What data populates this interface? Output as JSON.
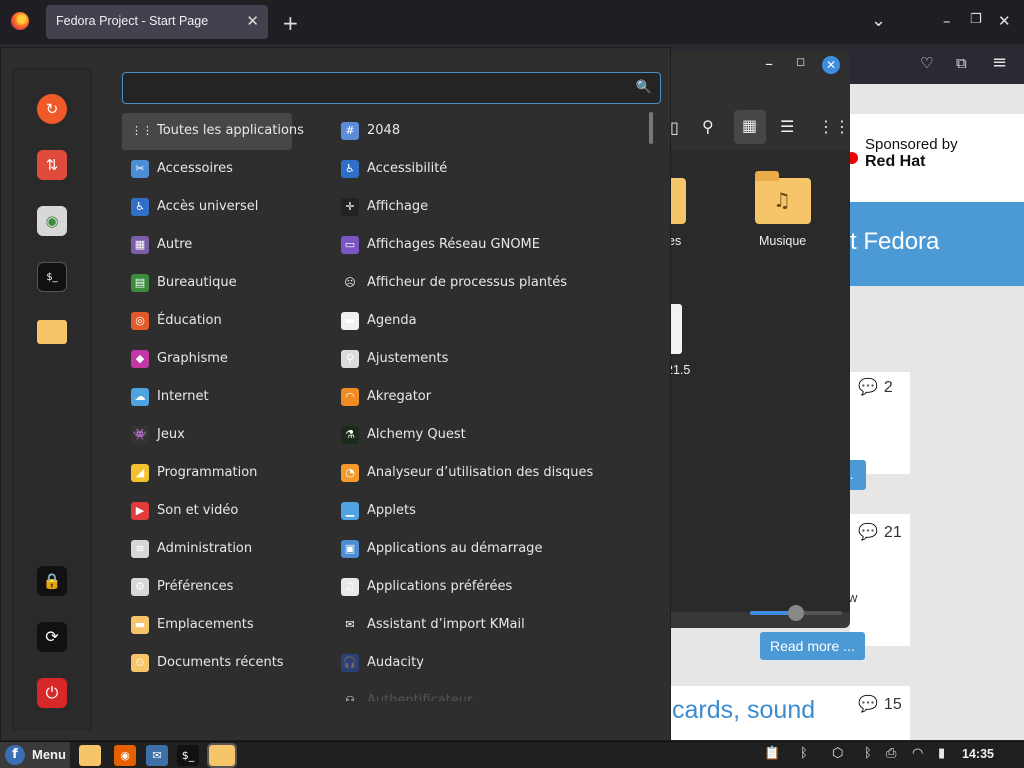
{
  "browser": {
    "tab_title": "Fedora Project - Start Page",
    "tab_close": "✕",
    "new_tab": "+",
    "tab_list": "⌄",
    "minimize": "–",
    "maximize": "❐",
    "close": "✕",
    "pocket": "♡",
    "extensions": "⧉",
    "hamburger": "≡"
  },
  "webpage": {
    "sponsor_line1": "Sponsored by",
    "sponsor_line2": "Red Hat",
    "banner_text": "t Fedora",
    "comment_counts": [
      "2",
      "21",
      "15"
    ],
    "read_more": "Read more ...",
    "article_title_fragment": "cards, sound",
    "fragment_w": "w",
    "button_fragment": "..."
  },
  "file_manager": {
    "folders": [
      {
        "label": "es"
      },
      {
        "label": "Musique"
      }
    ],
    "file_label": "21.5",
    "zoom_level": 0.5
  },
  "menu": {
    "search": {
      "value": "",
      "placeholder": ""
    },
    "favorites": [
      {
        "name": "firefox",
        "icon": "firefox-icon"
      },
      {
        "name": "software",
        "icon": "software-icon"
      },
      {
        "name": "settings",
        "icon": "toggle-settings-icon"
      },
      {
        "name": "terminal",
        "icon": "terminal-icon"
      },
      {
        "name": "files",
        "icon": "folder-icon"
      }
    ],
    "session": [
      {
        "name": "lock",
        "icon": "lock-icon"
      },
      {
        "name": "logout",
        "icon": "logout-icon"
      },
      {
        "name": "shutdown",
        "icon": "power-icon"
      }
    ],
    "categories": [
      {
        "label": "Toutes les applications",
        "color": "#474747",
        "glyph": "⋮⋮"
      },
      {
        "label": "Accessoires",
        "color": "#4c8dd6",
        "glyph": "✂"
      },
      {
        "label": "Accès universel",
        "color": "#2f6fc8",
        "glyph": "♿"
      },
      {
        "label": "Autre",
        "color": "#7b5ea7",
        "glyph": "▦"
      },
      {
        "label": "Bureautique",
        "color": "#3d8b3d",
        "glyph": "▤"
      },
      {
        "label": "Éducation",
        "color": "#e25a2a",
        "glyph": "◎"
      },
      {
        "label": "Graphisme",
        "color": "#c236a5",
        "glyph": "◆"
      },
      {
        "label": "Internet",
        "color": "#4fa3e0",
        "glyph": "☁"
      },
      {
        "label": "Jeux",
        "color": "#333333",
        "glyph": "👾"
      },
      {
        "label": "Programmation",
        "color": "#f2c22e",
        "glyph": "◢"
      },
      {
        "label": "Son et vidéo",
        "color": "#e33b3b",
        "glyph": "▶"
      },
      {
        "label": "Administration",
        "color": "#d8d8d8",
        "glyph": "≡"
      },
      {
        "label": "Préférences",
        "color": "#d8d8d8",
        "glyph": "⚙"
      },
      {
        "label": "Emplacements",
        "color": "#f6c56a",
        "glyph": "▬"
      },
      {
        "label": "Documents récents",
        "color": "#f6c56a",
        "glyph": "⏲"
      }
    ],
    "apps": [
      {
        "label": "2048",
        "color": "#5b8bd9",
        "glyph": "#"
      },
      {
        "label": "Accessibilité",
        "color": "#2f6fc8",
        "glyph": "♿"
      },
      {
        "label": "Affichage",
        "color": "#222222",
        "glyph": "✛"
      },
      {
        "label": "Affichages Réseau GNOME",
        "color": "#7b55c4",
        "glyph": "▭"
      },
      {
        "label": "Afficheur de processus plantés",
        "color": "#2e2e2e",
        "glyph": "☹"
      },
      {
        "label": "Agenda",
        "color": "#f0f0f0",
        "glyph": "▬"
      },
      {
        "label": "Ajustements",
        "color": "#dcdcdc",
        "glyph": "⚲"
      },
      {
        "label": "Akregator",
        "color": "#f08a24",
        "glyph": "◠"
      },
      {
        "label": "Alchemy Quest",
        "color": "#1c2b1c",
        "glyph": "⚗"
      },
      {
        "label": "Analyseur d’utilisation des disques",
        "color": "#f39a2b",
        "glyph": "◔"
      },
      {
        "label": "Applets",
        "color": "#4fa3e0",
        "glyph": "▁"
      },
      {
        "label": "Applications au démarrage",
        "color": "#4c8dd6",
        "glyph": "▣"
      },
      {
        "label": "Applications préférées",
        "color": "#e8e8e8",
        "glyph": "♫"
      },
      {
        "label": "Assistant d’import KMail",
        "color": "#2e2e2e",
        "glyph": "✉"
      },
      {
        "label": "Audacity",
        "color": "#2b3f7a",
        "glyph": "🎧"
      },
      {
        "label": "Authentificateur",
        "color": "#2e2e2e",
        "glyph": "⚇"
      }
    ]
  },
  "panel": {
    "menu_label": "Menu",
    "fedora_glyph": "f",
    "tasks": [
      {
        "name": "files",
        "icon": "folder-icon",
        "color": "#f6c56a",
        "glyph": ""
      },
      {
        "name": "firefox",
        "icon": "firefox-icon",
        "color": "#e66000",
        "glyph": "◉"
      },
      {
        "name": "mail",
        "icon": "mail-icon",
        "color": "#3d6fa8",
        "glyph": "✉"
      },
      {
        "name": "terminal",
        "icon": "terminal-icon",
        "color": "#111111",
        "glyph": "$_"
      },
      {
        "name": "file-manager-window",
        "icon": "folder-icon",
        "color": "#f6c56a",
        "glyph": ""
      }
    ],
    "tray": [
      {
        "name": "clipboard",
        "icon": "clipboard-icon",
        "glyph": "📋"
      },
      {
        "name": "bluetooth-off",
        "icon": "bluetooth-icon",
        "glyph": "ᛒ"
      },
      {
        "name": "package",
        "icon": "package-icon",
        "glyph": "⬡"
      },
      {
        "name": "bluetooth",
        "icon": "bluetooth-icon",
        "glyph": "ᛒ"
      },
      {
        "name": "printer",
        "icon": "printer-icon",
        "glyph": "⎙"
      },
      {
        "name": "wifi",
        "icon": "wifi-icon",
        "glyph": "◠"
      },
      {
        "name": "battery",
        "icon": "battery-icon",
        "glyph": "▮"
      }
    ],
    "clock": "14:35",
    "colors": {
      "accent": "#4a90c8",
      "fedora_blue": "#3c6eb4"
    }
  }
}
